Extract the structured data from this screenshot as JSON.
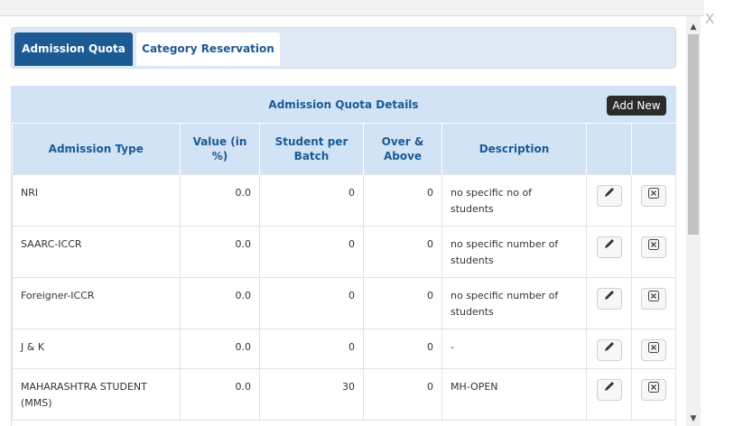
{
  "window": {
    "close_glyph": "X"
  },
  "tabs": [
    {
      "label": "Admission Quota",
      "active": true
    },
    {
      "label": "Category Reservation",
      "active": false
    }
  ],
  "panel": {
    "title": "Admission Quota Details",
    "add_label": "Add New"
  },
  "table": {
    "headers": [
      "Admission Type",
      "Value (in %)",
      "Student per Batch",
      "Over & Above",
      "Description",
      "",
      ""
    ],
    "rows": [
      {
        "type": "NRI",
        "value": "0.0",
        "per_batch": "0",
        "over": "0",
        "desc": "no specific no of students"
      },
      {
        "type": "SAARC-ICCR",
        "value": "0.0",
        "per_batch": "0",
        "over": "0",
        "desc": "no specific number of students"
      },
      {
        "type": "Foreigner-ICCR",
        "value": "0.0",
        "per_batch": "0",
        "over": "0",
        "desc": "no specific number of students"
      },
      {
        "type": "J & K",
        "value": "0.0",
        "per_batch": "0",
        "over": "0",
        "desc": "-"
      },
      {
        "type": "MAHARASHTRA STUDENT (MMS)",
        "value": "0.0",
        "per_batch": "30",
        "over": "0",
        "desc": "MH-OPEN"
      }
    ]
  },
  "colors": {
    "accent": "#1c5a93",
    "header_bg": "#d2e3f6",
    "tab_bar_bg": "#dfe9f6"
  },
  "icons": {
    "edit": "pencil-icon",
    "delete": "close-box-icon"
  }
}
